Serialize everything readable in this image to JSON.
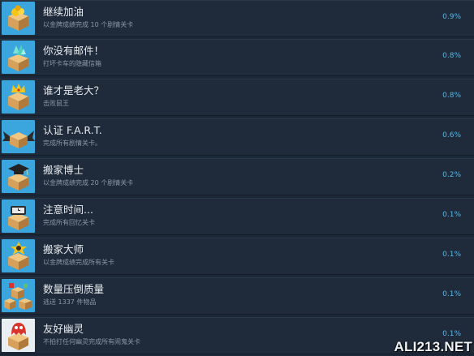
{
  "achievements": [
    {
      "title": "继续加油",
      "desc": "以金牌成绩完成 10 个剧情关卡",
      "pct": "0.9%",
      "icon": "box-with-gold-icon"
    },
    {
      "title": "你没有邮件！",
      "desc": "打坏卡车的隐藏信箱",
      "pct": "0.8%",
      "icon": "box-with-crystal-icon"
    },
    {
      "title": "谁才是老大？",
      "desc": "击败鼠王",
      "pct": "0.8%",
      "icon": "box-with-crown-icon"
    },
    {
      "title": "认证 F.A.R.T.",
      "desc": "完成所有剧情关卡。",
      "pct": "0.6%",
      "icon": "box-with-wings-icon"
    },
    {
      "title": "搬家博士",
      "desc": "以金牌成绩完成 20 个剧情关卡",
      "pct": "0.2%",
      "icon": "box-with-graduation-cap-icon"
    },
    {
      "title": "注意时间...",
      "desc": "完成所有回忆关卡",
      "pct": "0.1%",
      "icon": "box-with-clock-icon"
    },
    {
      "title": "搬家大师",
      "desc": "以金牌成绩完成所有关卡",
      "pct": "0.1%",
      "icon": "box-with-medal-icon"
    },
    {
      "title": "数量压倒质量",
      "desc": "逃送 1337 件物品",
      "pct": "0.1%",
      "icon": "box-pile-icon"
    },
    {
      "title": "友好幽灵",
      "desc": "不拍打任何幽灵完成所有闹鬼关卡",
      "pct": "0.1%",
      "icon": "box-with-ghost-icon"
    }
  ],
  "watermark": "ALI213.NET",
  "colors": {
    "background": "#1b2838",
    "row": "#1f2b3a",
    "icon_bg": "#3ba5dd",
    "percent": "#59b6e8",
    "box": "#d7a15b"
  }
}
